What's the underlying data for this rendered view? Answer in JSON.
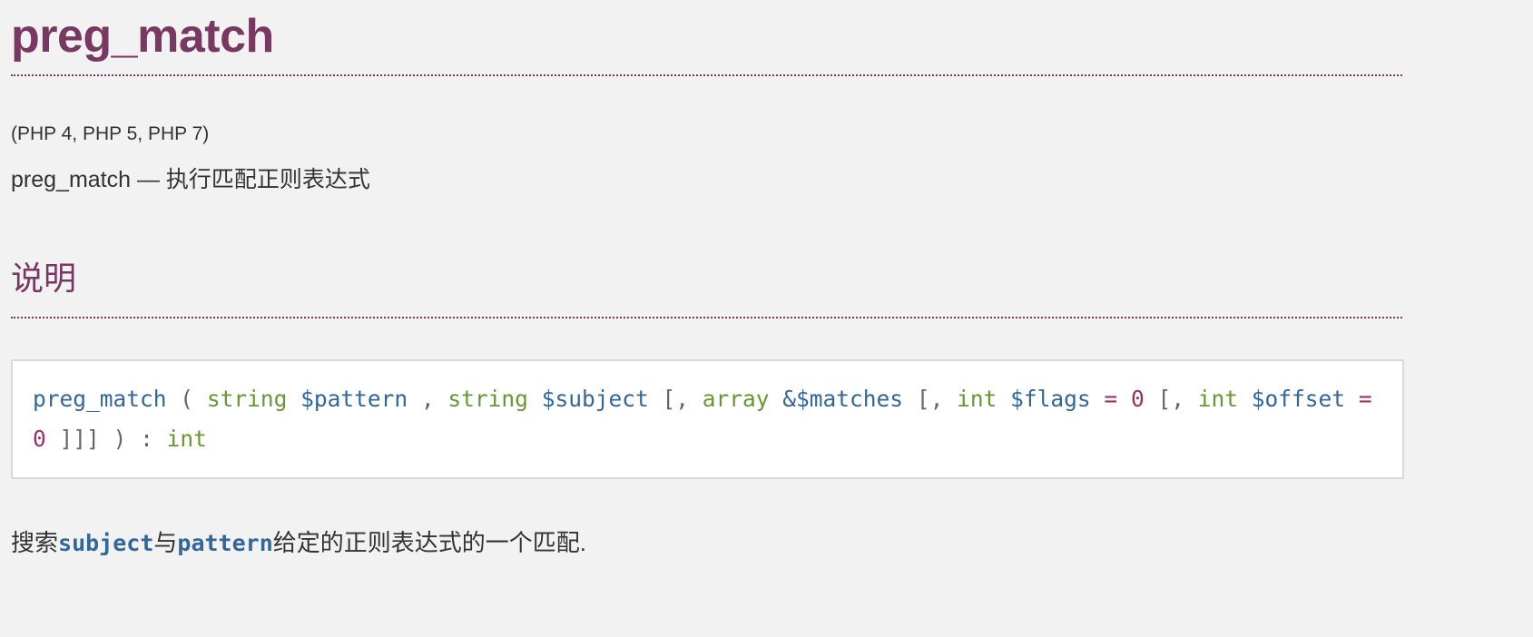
{
  "title": "preg_match",
  "versions": "(PHP 4, PHP 5, PHP 7)",
  "refpurpose": "preg_match — 执行匹配正则表达式",
  "section_heading": "说明",
  "synopsis": {
    "function": "preg_match",
    "open_paren": "(",
    "params": [
      {
        "type": "string",
        "name": "$pattern"
      },
      {
        "type": "string",
        "name": "$subject"
      },
      {
        "type": "array",
        "name": "&$matches"
      },
      {
        "type": "int",
        "name": "$flags",
        "default": "0"
      },
      {
        "type": "int",
        "name": "$offset",
        "default": "0"
      }
    ],
    "comma": ",",
    "opt_open": "[,",
    "eq": "=",
    "opt_close": "]]]",
    "close_paren": ")",
    "colon": ":",
    "return_type": "int"
  },
  "description": {
    "part1": "搜索",
    "code1": "subject",
    "part2": "与",
    "code2": "pattern",
    "part3": "给定的正则表达式的一个匹配."
  },
  "colors": {
    "heading": "#793862",
    "name": "#336699",
    "type": "#669933",
    "number": "#993366",
    "background": "#f2f2f2"
  }
}
